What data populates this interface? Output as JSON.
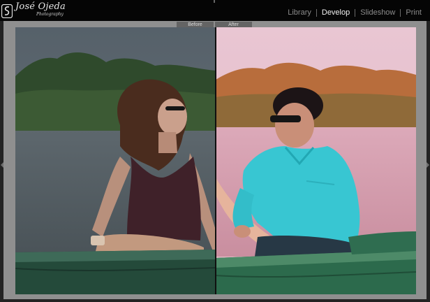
{
  "brand": {
    "name": "José Ojeda",
    "sub": "Photography"
  },
  "modules": [
    {
      "label": "Library",
      "active": false
    },
    {
      "label": "Develop",
      "active": true
    },
    {
      "label": "Slideshow",
      "active": false
    },
    {
      "label": "Print",
      "active": false
    }
  ],
  "compare": {
    "before_label": "Before",
    "after_label": "After"
  },
  "colors": {
    "before_sky": "#4e5a63",
    "after_sky": "#e7c4d1",
    "after_water": "#d8a3b6",
    "boat_green": "#2e5a46",
    "shirt_teal": "#37c6d0"
  }
}
